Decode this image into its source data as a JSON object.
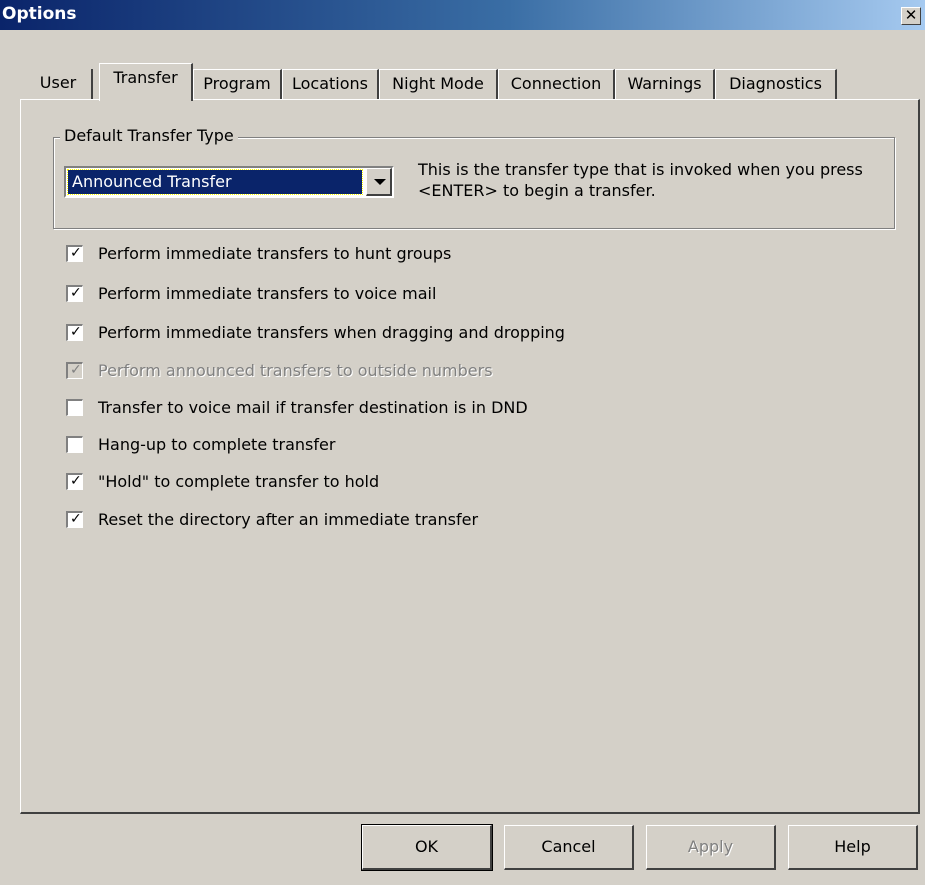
{
  "window": {
    "title": "Options"
  },
  "tabs": [
    {
      "label": "User"
    },
    {
      "label": "Transfer",
      "selected": true
    },
    {
      "label": "Program"
    },
    {
      "label": "Locations"
    },
    {
      "label": "Night Mode"
    },
    {
      "label": "Connection"
    },
    {
      "label": "Warnings"
    },
    {
      "label": "Diagnostics"
    }
  ],
  "default_transfer": {
    "group_label": "Default Transfer Type",
    "selected_value": "Announced Transfer",
    "description_line1": "This is the transfer type that is invoked when you press",
    "description_line2": "<ENTER> to begin a transfer."
  },
  "options": [
    {
      "label": "Perform immediate transfers to hunt groups",
      "checked": true,
      "enabled": true
    },
    {
      "label": "Perform immediate transfers to voice mail",
      "checked": true,
      "enabled": true
    },
    {
      "label": "Perform immediate transfers when dragging and dropping",
      "checked": true,
      "enabled": true
    },
    {
      "label": "Perform announced transfers to outside numbers",
      "checked": true,
      "enabled": false
    },
    {
      "label": "Transfer to voice mail if transfer destination is in DND",
      "checked": false,
      "enabled": true
    },
    {
      "label": "Hang-up to complete transfer",
      "checked": false,
      "enabled": true
    },
    {
      "label": "\"Hold\" to complete transfer to hold",
      "checked": true,
      "enabled": true
    },
    {
      "label": "Reset the directory after an immediate transfer",
      "checked": true,
      "enabled": true
    }
  ],
  "buttons": {
    "ok": "OK",
    "cancel": "Cancel",
    "apply": "Apply",
    "help": "Help"
  },
  "icons": {
    "close": "close-icon",
    "dropdown": "chevron-down-icon",
    "check": "check-icon"
  }
}
